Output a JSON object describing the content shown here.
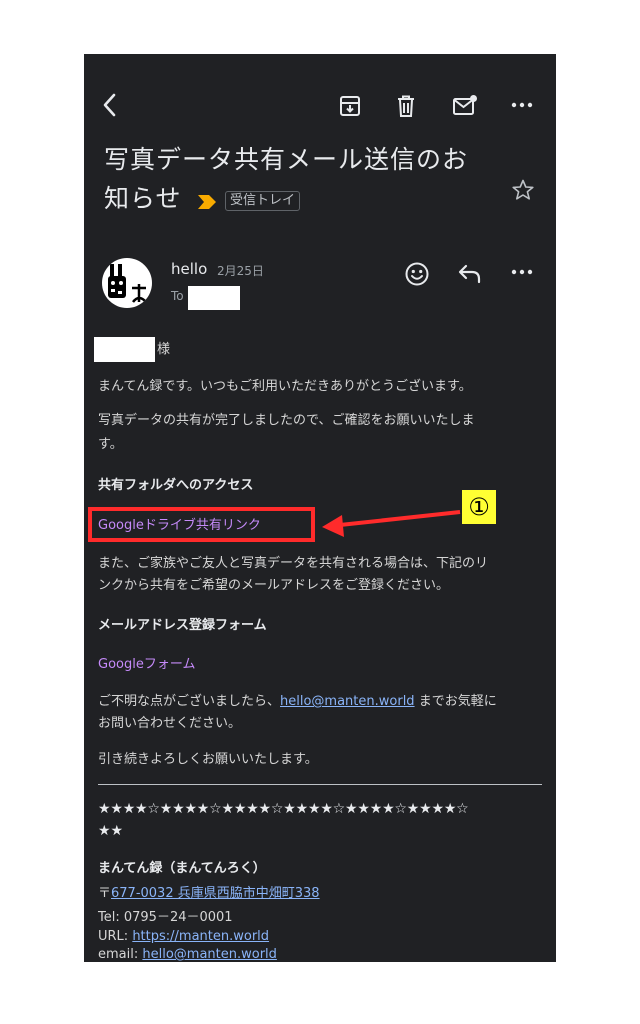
{
  "email": {
    "subject_line1": "写真データ共有メール送信のお",
    "subject_line2": "知らせ",
    "label_tag": "受信トレイ",
    "sender_name": "hello",
    "date": "2月25日",
    "to_prefix": "To"
  },
  "body": {
    "salutation_suffix": "様",
    "p1": "まんてん録です。いつもご利用いただきありがとうございます。",
    "p2_line1": "写真データの共有が完了しましたので、ご確認をお願いいたしま",
    "p2_line2": "す。",
    "heading_access": "共有フォルダへのアクセス",
    "drive_link": "Googleドライブ共有リンク",
    "p3_line1": "また、ご家族やご友人と写真データを共有される場合は、下記のリ",
    "p3_line2": "ンクから共有をご希望のメールアドレスをご登録ください。",
    "heading_form": "メールアドレス登録フォーム",
    "form_link": "Googleフォーム",
    "p4_prefix": "ご不明な点がございましたら、",
    "p4_email": "hello@manten.world",
    "p4_suffix": " までお気軽に",
    "p4_line2": "お問い合わせください。",
    "closing": "引き続きよろしくお願いいたします。",
    "stars_line1": "★★★★☆★★★★☆★★★★☆★★★★☆★★★★☆★★★★☆",
    "stars_line2": "★★",
    "company": "まんてん録（まんてんろく）",
    "postal_mark": "〒",
    "postal_address": "677-0032 兵庫県西脇市中畑町338",
    "tel": "Tel: 0795－24－0001",
    "url_prefix": "URL: ",
    "url": "https://manten.world",
    "email_prefix": "email: ",
    "email_addr": "hello@manten.world"
  },
  "annotation": {
    "marker": "①",
    "highlight_color": "#ff2b2b",
    "marker_bg": "#ffff33"
  },
  "colors": {
    "background": "#202124",
    "link_purple": "#c58af9",
    "link_blue": "#8ab4f8",
    "important_marker": "#f9ab00"
  }
}
